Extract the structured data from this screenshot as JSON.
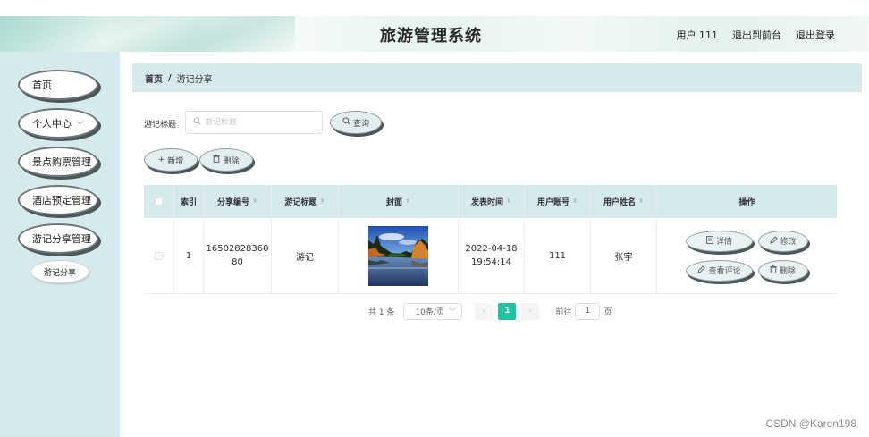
{
  "header": {
    "title": "旅游管理系统",
    "user_label": "用户 111",
    "to_front": "退出到前台",
    "logout": "退出登录"
  },
  "sidebar": {
    "items": [
      {
        "label": "首页",
        "icon": "none"
      },
      {
        "label": "个人中心",
        "icon": "chevron-down-icon"
      },
      {
        "label": "景点购票管理"
      },
      {
        "label": "酒店预定管理"
      },
      {
        "label": "游记分享管理"
      }
    ],
    "submenu": {
      "label": "游记分享"
    }
  },
  "breadcrumb": {
    "home": "首页",
    "separator": "/",
    "current": "游记分享"
  },
  "search": {
    "label": "游记标题",
    "placeholder": "游记标题",
    "value": "",
    "query_button": "查询"
  },
  "toolbar": {
    "add_label": "新增",
    "delete_label": "删除"
  },
  "table": {
    "columns": [
      "",
      "索引",
      "分享编号",
      "游记标题",
      "封面",
      "发表时间",
      "用户账号",
      "用户姓名",
      "操作"
    ],
    "rows": [
      {
        "index": "1",
        "share_no_line1": "16502828360",
        "share_no_line2": "80",
        "title": "游记",
        "cover_alt": "lake-landscape-photo",
        "time_date": "2022-04-18",
        "time_clock": "19:54:14",
        "account": "111",
        "name": "张宇",
        "actions": {
          "detail": "详情",
          "edit": "修改",
          "comment": "查看评论",
          "delete": "删除"
        }
      }
    ]
  },
  "pagination": {
    "total": "共 1 条",
    "page_size": "10条/页",
    "current_page": "1",
    "goto_label": "前往",
    "goto_value": "1",
    "page_unit": "页"
  },
  "watermark": "CSDN @Karen198",
  "colors": {
    "accent": "#23c1a3",
    "panel": "#d6e9ed",
    "button_shadow": "#47565a"
  }
}
